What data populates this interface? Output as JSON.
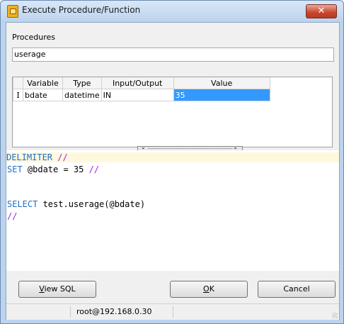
{
  "window": {
    "title": "Execute Procedure/Function",
    "close_label": "✕"
  },
  "procedures": {
    "label": "Procedures",
    "value": "userage"
  },
  "grid": {
    "columns": [
      "Variable",
      "Type",
      "Input/Output",
      "Value"
    ],
    "rows": [
      {
        "indicator": "I",
        "variable": "bdate",
        "type": "datetime",
        "io": "IN",
        "value": "35"
      }
    ]
  },
  "splitter": {
    "left_glyph": "⌄",
    "right_glyph": "⌄"
  },
  "sql": {
    "l1_kw": "DELIMITER",
    "l1_rest": " //",
    "l2_kw": "SET",
    "l2_mid": " @bdate = 35 ",
    "l2_end": "//",
    "l5_kw": "SELECT",
    "l5_rest": " test.userage(@bdate)",
    "l6": "//"
  },
  "buttons": {
    "view_sql": {
      "accel": "V",
      "rest": "iew SQL"
    },
    "ok": {
      "accel": "O",
      "rest": "K"
    },
    "cancel": "Cancel"
  },
  "status": {
    "connection": "root@192.168.0.30"
  }
}
